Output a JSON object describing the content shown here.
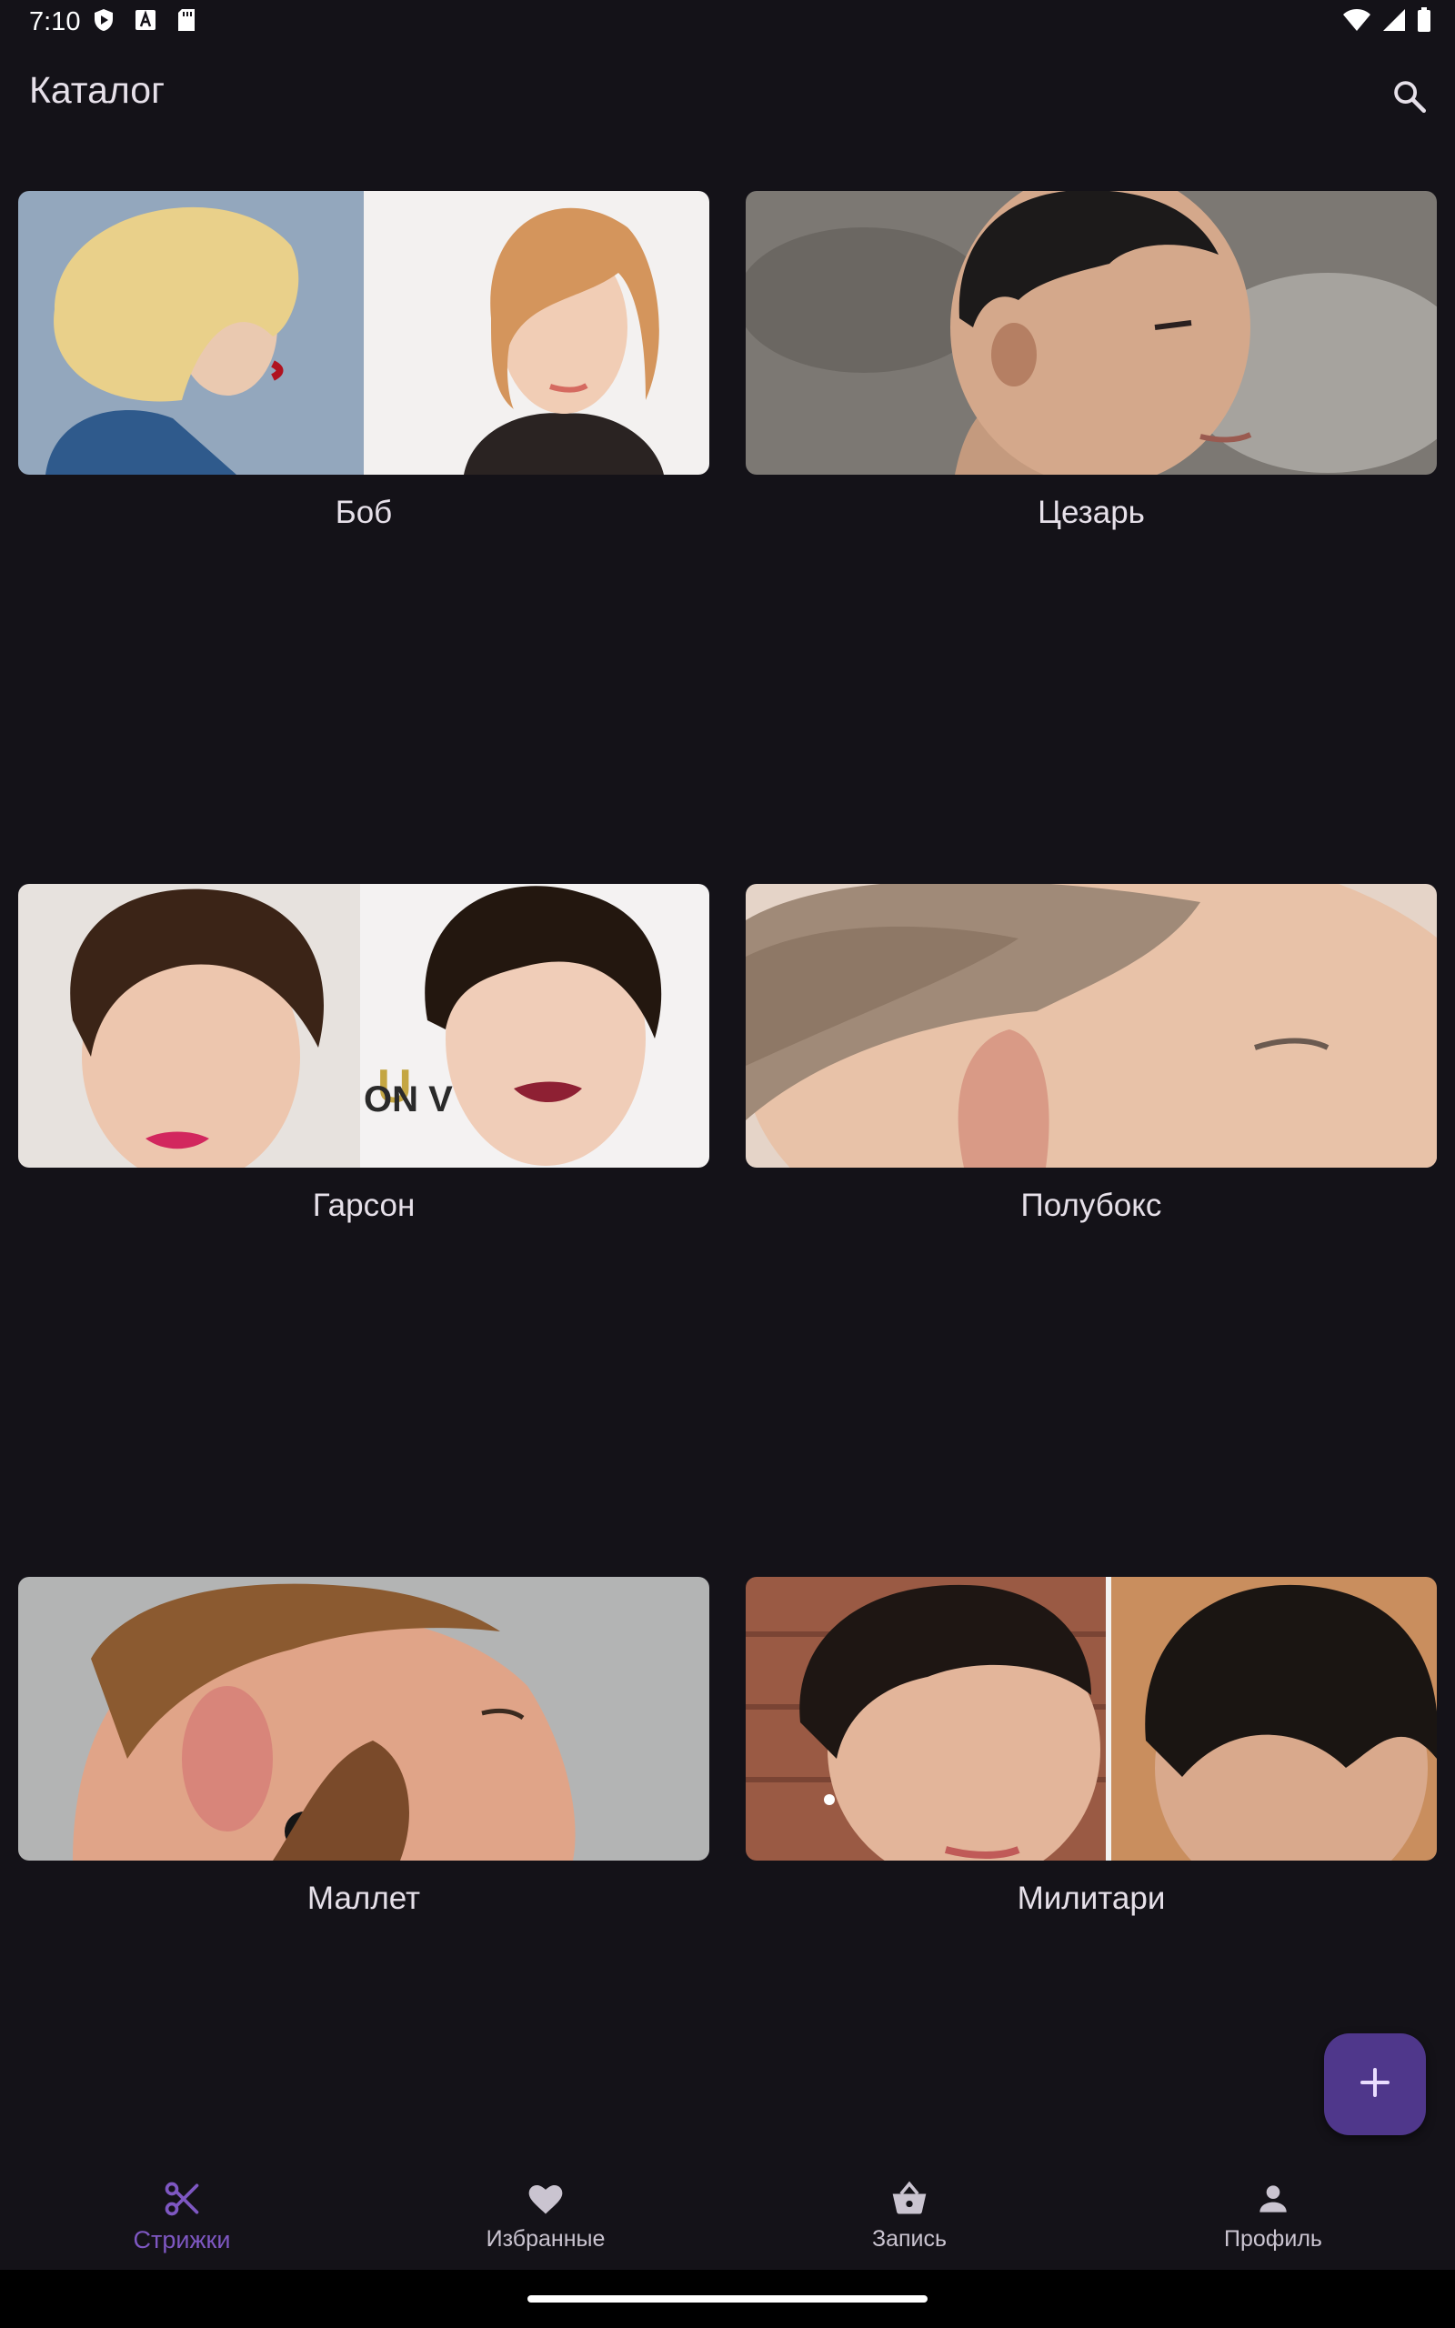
{
  "status_bar": {
    "time": "7:10",
    "left_icons": [
      "play-protect-icon",
      "a-icon",
      "sd-card-icon"
    ],
    "right_icons": [
      "wifi-icon",
      "signal-icon",
      "battery-icon"
    ]
  },
  "app_bar": {
    "title": "Каталог",
    "search_icon": "search-icon"
  },
  "catalog": {
    "items": [
      {
        "label": "Боб"
      },
      {
        "label": "Цезарь"
      },
      {
        "label": "Гарсон"
      },
      {
        "label": "Полубокс"
      },
      {
        "label": "Маллет"
      },
      {
        "label": "Милитари"
      }
    ]
  },
  "fab": {
    "icon": "plus-icon"
  },
  "bottom_nav": {
    "items": [
      {
        "label": "Стрижки",
        "icon": "scissors-icon",
        "active": true
      },
      {
        "label": "Избранные",
        "icon": "heart-icon",
        "active": false
      },
      {
        "label": "Запись",
        "icon": "basket-icon",
        "active": false
      },
      {
        "label": "Профиль",
        "icon": "person-icon",
        "active": false
      }
    ]
  },
  "colors": {
    "background": "#141218",
    "accent": "#7E57C2",
    "fab": "#4F378B",
    "text": "#E6E0E9"
  }
}
